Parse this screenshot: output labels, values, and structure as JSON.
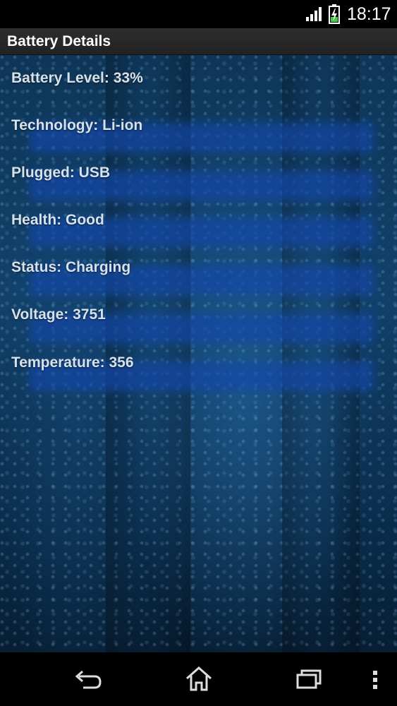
{
  "status_bar": {
    "time": "18:17",
    "icons": [
      "signal-icon",
      "battery-charging-icon"
    ]
  },
  "action_bar": {
    "title": "Battery Details"
  },
  "details": [
    {
      "label": "Battery Level: 33%"
    },
    {
      "label": "Technology: Li-ion"
    },
    {
      "label": "Plugged: USB"
    },
    {
      "label": "Health: Good"
    },
    {
      "label": "Status: Charging"
    },
    {
      "label": "Voltage: 3751"
    },
    {
      "label": "Temperature: 356"
    }
  ],
  "nav_bar": {
    "icons": [
      "back-icon",
      "home-icon",
      "recents-icon",
      "overflow-menu-icon"
    ]
  },
  "colors": {
    "status_bar_bg": "#000000",
    "action_bar_bg": "#2a2a2a",
    "text": "#d6e1ea",
    "background_blue": "#11416a",
    "highlight_bar": "#1446aa",
    "battery_charge": "#3fcf3f"
  }
}
